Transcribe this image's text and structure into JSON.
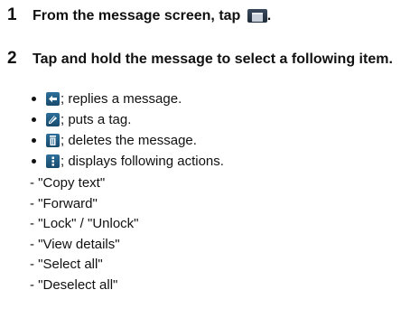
{
  "steps": [
    {
      "number": "1",
      "text_before": "From the message screen, tap ",
      "text_after": ".",
      "icon": "folder-icon"
    },
    {
      "number": "2",
      "text": "Tap and hold the message to select a following item."
    }
  ],
  "bullets": [
    {
      "icon": "reply-icon",
      "text": "; replies a message."
    },
    {
      "icon": "tag-icon",
      "text": "; puts a tag."
    },
    {
      "icon": "trash-icon",
      "text": "; deletes the message."
    },
    {
      "icon": "more-actions-icon",
      "text": "; displays following actions."
    }
  ],
  "actions": [
    "- \"Copy text\"",
    "- \"Forward\"",
    "- \"Lock\" / \"Unlock\"",
    "- \"View details\"",
    "- \"Select all\"",
    "- \"Deselect all\""
  ]
}
